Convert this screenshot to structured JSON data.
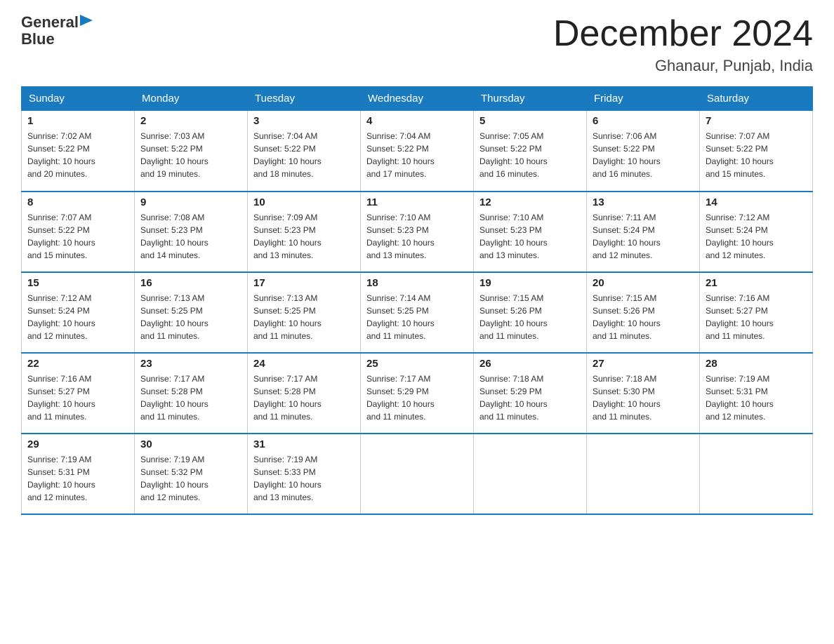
{
  "header": {
    "logo_line1": "General",
    "logo_line2": "Blue",
    "month_title": "December 2024",
    "location": "Ghanaur, Punjab, India"
  },
  "days_of_week": [
    "Sunday",
    "Monday",
    "Tuesday",
    "Wednesday",
    "Thursday",
    "Friday",
    "Saturday"
  ],
  "weeks": [
    [
      {
        "num": "1",
        "info": "Sunrise: 7:02 AM\nSunset: 5:22 PM\nDaylight: 10 hours\nand 20 minutes."
      },
      {
        "num": "2",
        "info": "Sunrise: 7:03 AM\nSunset: 5:22 PM\nDaylight: 10 hours\nand 19 minutes."
      },
      {
        "num": "3",
        "info": "Sunrise: 7:04 AM\nSunset: 5:22 PM\nDaylight: 10 hours\nand 18 minutes."
      },
      {
        "num": "4",
        "info": "Sunrise: 7:04 AM\nSunset: 5:22 PM\nDaylight: 10 hours\nand 17 minutes."
      },
      {
        "num": "5",
        "info": "Sunrise: 7:05 AM\nSunset: 5:22 PM\nDaylight: 10 hours\nand 16 minutes."
      },
      {
        "num": "6",
        "info": "Sunrise: 7:06 AM\nSunset: 5:22 PM\nDaylight: 10 hours\nand 16 minutes."
      },
      {
        "num": "7",
        "info": "Sunrise: 7:07 AM\nSunset: 5:22 PM\nDaylight: 10 hours\nand 15 minutes."
      }
    ],
    [
      {
        "num": "8",
        "info": "Sunrise: 7:07 AM\nSunset: 5:22 PM\nDaylight: 10 hours\nand 15 minutes."
      },
      {
        "num": "9",
        "info": "Sunrise: 7:08 AM\nSunset: 5:23 PM\nDaylight: 10 hours\nand 14 minutes."
      },
      {
        "num": "10",
        "info": "Sunrise: 7:09 AM\nSunset: 5:23 PM\nDaylight: 10 hours\nand 13 minutes."
      },
      {
        "num": "11",
        "info": "Sunrise: 7:10 AM\nSunset: 5:23 PM\nDaylight: 10 hours\nand 13 minutes."
      },
      {
        "num": "12",
        "info": "Sunrise: 7:10 AM\nSunset: 5:23 PM\nDaylight: 10 hours\nand 13 minutes."
      },
      {
        "num": "13",
        "info": "Sunrise: 7:11 AM\nSunset: 5:24 PM\nDaylight: 10 hours\nand 12 minutes."
      },
      {
        "num": "14",
        "info": "Sunrise: 7:12 AM\nSunset: 5:24 PM\nDaylight: 10 hours\nand 12 minutes."
      }
    ],
    [
      {
        "num": "15",
        "info": "Sunrise: 7:12 AM\nSunset: 5:24 PM\nDaylight: 10 hours\nand 12 minutes."
      },
      {
        "num": "16",
        "info": "Sunrise: 7:13 AM\nSunset: 5:25 PM\nDaylight: 10 hours\nand 11 minutes."
      },
      {
        "num": "17",
        "info": "Sunrise: 7:13 AM\nSunset: 5:25 PM\nDaylight: 10 hours\nand 11 minutes."
      },
      {
        "num": "18",
        "info": "Sunrise: 7:14 AM\nSunset: 5:25 PM\nDaylight: 10 hours\nand 11 minutes."
      },
      {
        "num": "19",
        "info": "Sunrise: 7:15 AM\nSunset: 5:26 PM\nDaylight: 10 hours\nand 11 minutes."
      },
      {
        "num": "20",
        "info": "Sunrise: 7:15 AM\nSunset: 5:26 PM\nDaylight: 10 hours\nand 11 minutes."
      },
      {
        "num": "21",
        "info": "Sunrise: 7:16 AM\nSunset: 5:27 PM\nDaylight: 10 hours\nand 11 minutes."
      }
    ],
    [
      {
        "num": "22",
        "info": "Sunrise: 7:16 AM\nSunset: 5:27 PM\nDaylight: 10 hours\nand 11 minutes."
      },
      {
        "num": "23",
        "info": "Sunrise: 7:17 AM\nSunset: 5:28 PM\nDaylight: 10 hours\nand 11 minutes."
      },
      {
        "num": "24",
        "info": "Sunrise: 7:17 AM\nSunset: 5:28 PM\nDaylight: 10 hours\nand 11 minutes."
      },
      {
        "num": "25",
        "info": "Sunrise: 7:17 AM\nSunset: 5:29 PM\nDaylight: 10 hours\nand 11 minutes."
      },
      {
        "num": "26",
        "info": "Sunrise: 7:18 AM\nSunset: 5:29 PM\nDaylight: 10 hours\nand 11 minutes."
      },
      {
        "num": "27",
        "info": "Sunrise: 7:18 AM\nSunset: 5:30 PM\nDaylight: 10 hours\nand 11 minutes."
      },
      {
        "num": "28",
        "info": "Sunrise: 7:19 AM\nSunset: 5:31 PM\nDaylight: 10 hours\nand 12 minutes."
      }
    ],
    [
      {
        "num": "29",
        "info": "Sunrise: 7:19 AM\nSunset: 5:31 PM\nDaylight: 10 hours\nand 12 minutes."
      },
      {
        "num": "30",
        "info": "Sunrise: 7:19 AM\nSunset: 5:32 PM\nDaylight: 10 hours\nand 12 minutes."
      },
      {
        "num": "31",
        "info": "Sunrise: 7:19 AM\nSunset: 5:33 PM\nDaylight: 10 hours\nand 13 minutes."
      },
      {
        "num": "",
        "info": ""
      },
      {
        "num": "",
        "info": ""
      },
      {
        "num": "",
        "info": ""
      },
      {
        "num": "",
        "info": ""
      }
    ]
  ]
}
